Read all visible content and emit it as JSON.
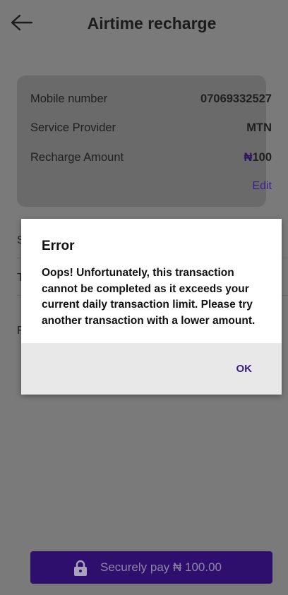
{
  "header": {
    "title": "Airtime recharge",
    "back_icon": "arrow-left-icon"
  },
  "summary": {
    "mobile_label": "Mobile number",
    "mobile_value": "07069332527",
    "provider_label": "Service Provider",
    "provider_value": "MTN",
    "amount_label": "Recharge Amount",
    "amount_currency": "₦",
    "amount_value": "100",
    "edit_label": "Edit"
  },
  "dialog": {
    "title": "Error",
    "message": "Oops! Unfortunately, this transaction cannot be completed as it exceeds your current daily transaction limit. Please try another transaction with a lower amount.",
    "ok_label": "OK"
  },
  "pay_button": {
    "label": "Securely pay ₦ 100.00",
    "icon": "lock-icon"
  },
  "colors": {
    "accent": "#2f0f6e",
    "link": "#3a1f8c",
    "overlay": "#7a7a7a"
  }
}
